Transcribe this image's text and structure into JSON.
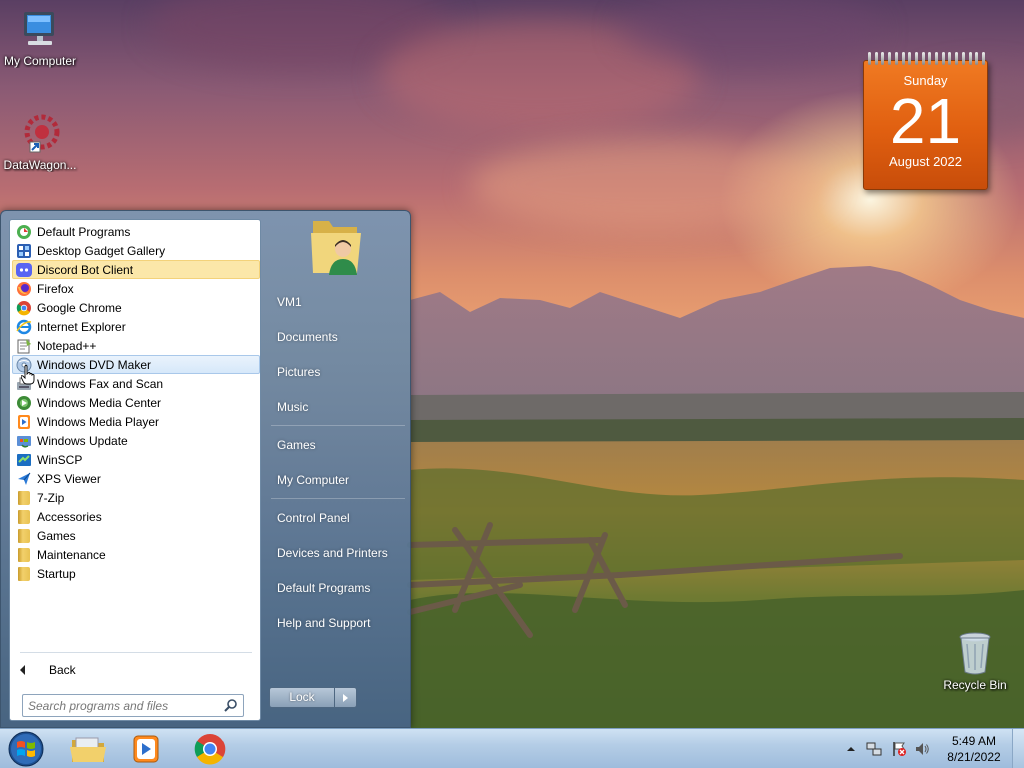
{
  "desktop": {
    "icons": [
      {
        "label": "My Computer"
      },
      {
        "label": "DataWagon..."
      },
      {
        "label": "Recycle Bin"
      }
    ]
  },
  "calendar": {
    "day_name": "Sunday",
    "date": "21",
    "month_year": "August 2022"
  },
  "start_menu": {
    "programs": [
      {
        "label": "Default Programs",
        "icon": "default-programs-icon"
      },
      {
        "label": "Desktop Gadget Gallery",
        "icon": "gadget-gallery-icon"
      },
      {
        "label": "Discord Bot Client",
        "icon": "discord-icon",
        "state": "selected"
      },
      {
        "label": "Firefox",
        "icon": "firefox-icon"
      },
      {
        "label": "Google Chrome",
        "icon": "chrome-icon"
      },
      {
        "label": "Internet Explorer",
        "icon": "internet-explorer-icon"
      },
      {
        "label": "Notepad++",
        "icon": "notepad-plus-plus-icon"
      },
      {
        "label": "Windows DVD Maker",
        "icon": "dvd-maker-icon",
        "state": "hover"
      },
      {
        "label": "Windows Fax and Scan",
        "icon": "fax-scan-icon"
      },
      {
        "label": "Windows Media Center",
        "icon": "media-center-icon"
      },
      {
        "label": "Windows Media Player",
        "icon": "media-player-icon"
      },
      {
        "label": "Windows Update",
        "icon": "windows-update-icon"
      },
      {
        "label": "WinSCP",
        "icon": "winscp-icon"
      },
      {
        "label": "XPS Viewer",
        "icon": "xps-viewer-icon"
      },
      {
        "label": "7-Zip",
        "icon": "folder-icon"
      },
      {
        "label": "Accessories",
        "icon": "folder-icon"
      },
      {
        "label": "Games",
        "icon": "folder-icon"
      },
      {
        "label": "Maintenance",
        "icon": "folder-icon"
      },
      {
        "label": "Startup",
        "icon": "folder-icon"
      }
    ],
    "back_label": "Back",
    "search_placeholder": "Search programs and files",
    "places": [
      {
        "label": "VM1"
      },
      {
        "label": "Documents"
      },
      {
        "label": "Pictures"
      },
      {
        "label": "Music"
      },
      {
        "label": "Games"
      },
      {
        "label": "My Computer"
      },
      {
        "label": "Control Panel"
      },
      {
        "label": "Devices and Printers"
      },
      {
        "label": "Default Programs"
      },
      {
        "label": "Help and Support"
      }
    ],
    "lock_label": "Lock"
  },
  "taskbar": {
    "pinned": [
      "windows-explorer-icon",
      "media-player-icon",
      "chrome-icon"
    ],
    "tray_icons": [
      "show-hidden-icons-arrow",
      "network-icon",
      "action-center-icon",
      "volume-icon"
    ],
    "clock_time": "5:49 AM",
    "clock_date": "8/21/2022"
  },
  "colors": {
    "calendar_orange": "#e05f10",
    "selected_item": "#fbe7a9",
    "hover_item": "#d6e8fa"
  }
}
